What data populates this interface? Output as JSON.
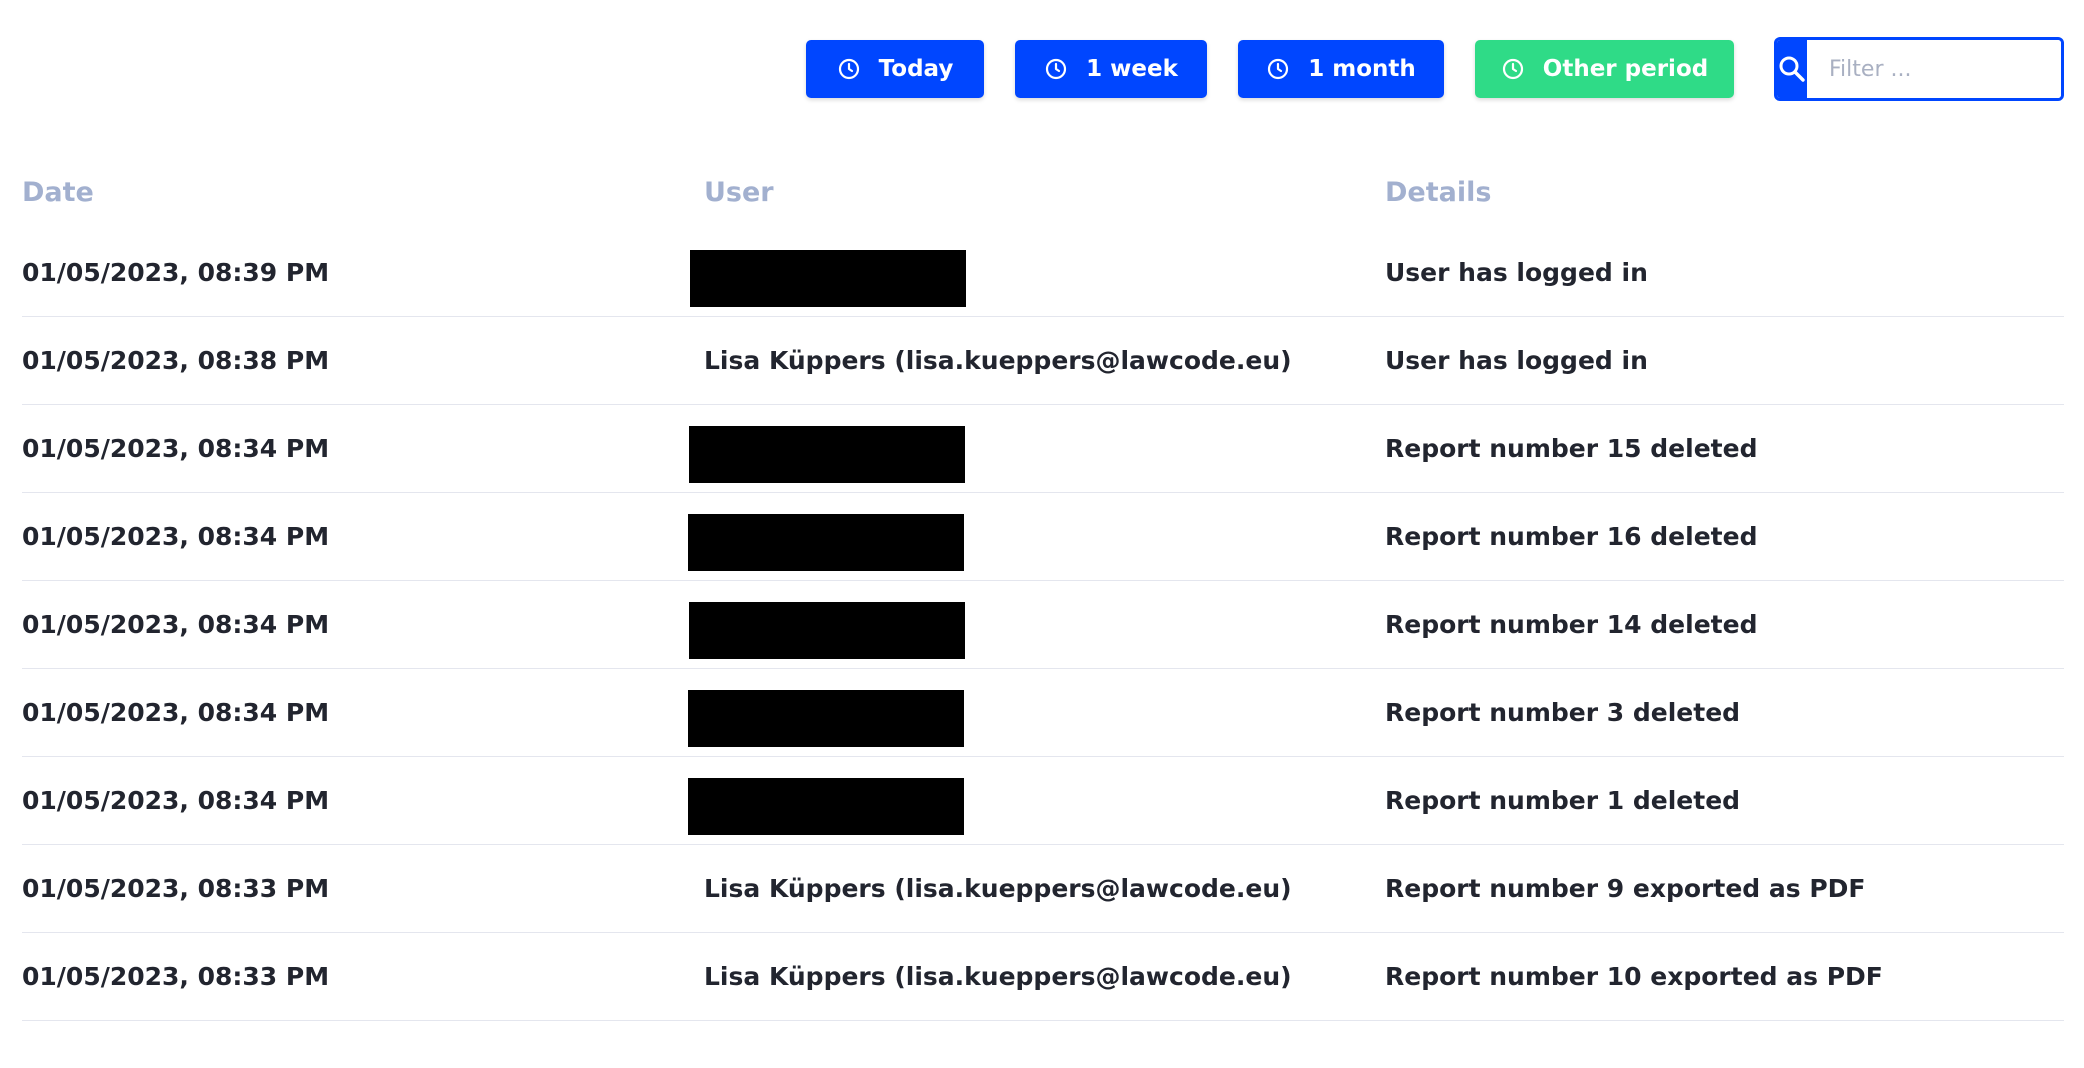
{
  "toolbar": {
    "buttons": [
      {
        "label": "Today",
        "icon": "clock-icon",
        "color": "#0046ff"
      },
      {
        "label": "1 week",
        "icon": "clock-icon",
        "color": "#0046ff"
      },
      {
        "label": "1 month",
        "icon": "clock-icon",
        "color": "#0046ff"
      },
      {
        "label": "Other period",
        "icon": "clock-icon",
        "color": "#2fdb87",
        "active": true
      }
    ],
    "search": {
      "icon": "search-icon",
      "placeholder": "Filter ...",
      "value": ""
    }
  },
  "table": {
    "headers": {
      "date": "Date",
      "user": "User",
      "details": "Details"
    },
    "rows": [
      {
        "date": "01/05/2023, 08:39 PM",
        "user": "",
        "user_redacted": true,
        "details": "User has logged in"
      },
      {
        "date": "01/05/2023, 08:38 PM",
        "user": "Lisa Küppers (lisa.kueppers@lawcode.eu)",
        "user_redacted": false,
        "details": "User has logged in"
      },
      {
        "date": "01/05/2023, 08:34 PM",
        "user": "",
        "user_redacted": true,
        "details": "Report number 15 deleted"
      },
      {
        "date": "01/05/2023, 08:34 PM",
        "user": "",
        "user_redacted": true,
        "details": "Report number 16 deleted"
      },
      {
        "date": "01/05/2023, 08:34 PM",
        "user": "",
        "user_redacted": true,
        "details": "Report number 14 deleted"
      },
      {
        "date": "01/05/2023, 08:34 PM",
        "user": "",
        "user_redacted": true,
        "details": "Report number 3 deleted"
      },
      {
        "date": "01/05/2023, 08:34 PM",
        "user": "",
        "user_redacted": true,
        "details": "Report number 1 deleted"
      },
      {
        "date": "01/05/2023, 08:33 PM",
        "user": "Lisa Küppers (lisa.kueppers@lawcode.eu)",
        "user_redacted": false,
        "details": "Report number 9 exported as PDF"
      },
      {
        "date": "01/05/2023, 08:33 PM",
        "user": "Lisa Küppers (lisa.kueppers@lawcode.eu)",
        "user_redacted": false,
        "details": "Report number 10 exported as PDF"
      }
    ]
  }
}
